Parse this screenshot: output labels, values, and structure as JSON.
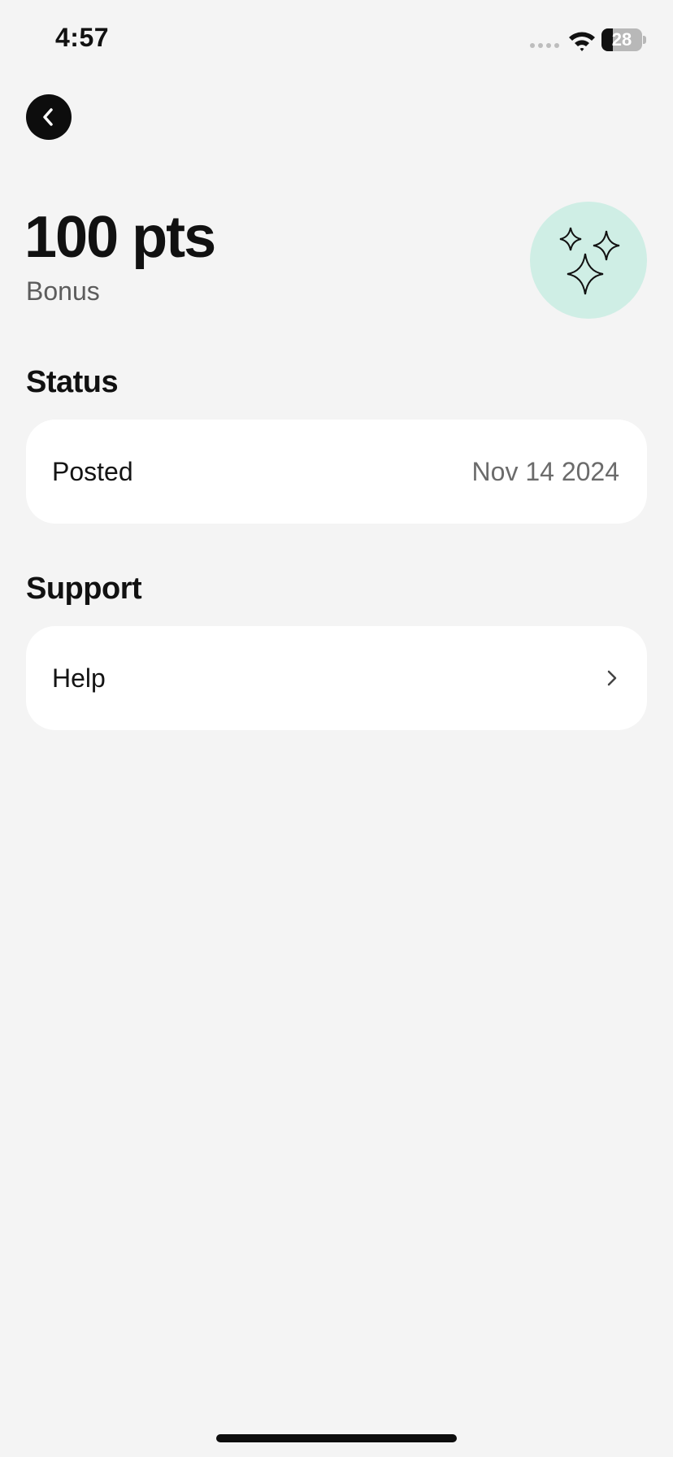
{
  "status_bar": {
    "time": "4:57",
    "battery_level": "28",
    "battery_fraction": 0.28
  },
  "back": {
    "icon": "chevron-left-icon"
  },
  "header": {
    "points": "100 pts",
    "type": "Bonus",
    "icon": "sparkles-icon",
    "icon_background": "#cfeee5"
  },
  "status_section": {
    "heading": "Status",
    "label": "Posted",
    "date": "Nov 14 2024"
  },
  "support_section": {
    "heading": "Support",
    "label": "Help",
    "icon": "chevron-right-icon"
  }
}
